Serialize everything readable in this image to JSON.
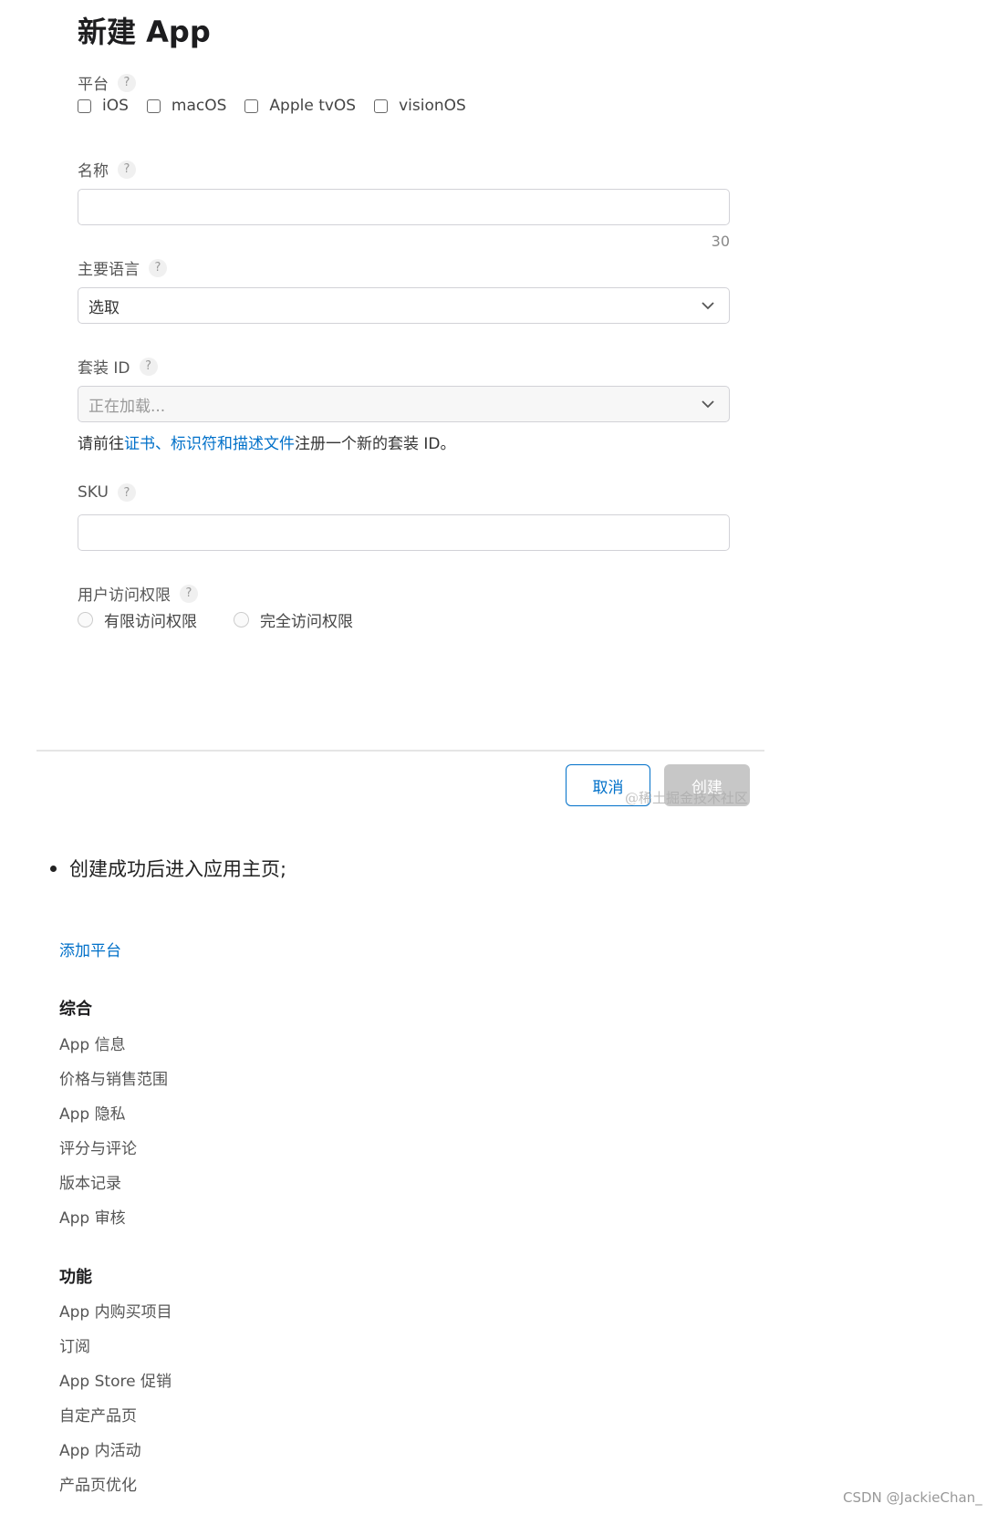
{
  "form": {
    "title": "新建 App",
    "help_glyph": "?",
    "platform": {
      "label": "平台",
      "options": [
        "iOS",
        "macOS",
        "Apple tvOS",
        "visionOS"
      ]
    },
    "name": {
      "label": "名称",
      "counter": "30",
      "value": ""
    },
    "language": {
      "label": "主要语言",
      "selected": "选取"
    },
    "bundle_id": {
      "label": "套装 ID",
      "selected": "正在加载...",
      "hint_prefix": "请前往",
      "hint_link": "证书、标识符和描述文件",
      "hint_suffix": "注册一个新的套装 ID。"
    },
    "sku": {
      "label": "SKU",
      "value": ""
    },
    "user_access": {
      "label": "用户访问权限",
      "options": [
        "有限访问权限",
        "完全访问权限"
      ]
    },
    "buttons": {
      "cancel": "取消",
      "create": "创建"
    }
  },
  "watermark": "@稀土掘金技术社区",
  "bullet": "创建成功后进入应用主页;",
  "sidebar": {
    "add_platform": "添加平台",
    "sections": [
      {
        "title": "综合",
        "items": [
          "App 信息",
          "价格与销售范围",
          "App 隐私",
          "评分与评论",
          "版本记录",
          "App 审核"
        ]
      },
      {
        "title": "功能",
        "items": [
          "App 内购买项目",
          "订阅",
          "App Store 促销",
          "自定产品页",
          "App 内活动",
          "产品页优化"
        ]
      }
    ]
  },
  "footer_credit": "CSDN @JackieChan_",
  "colors": {
    "link": "#0070c9",
    "disabled_button": "#c7c7c7"
  }
}
